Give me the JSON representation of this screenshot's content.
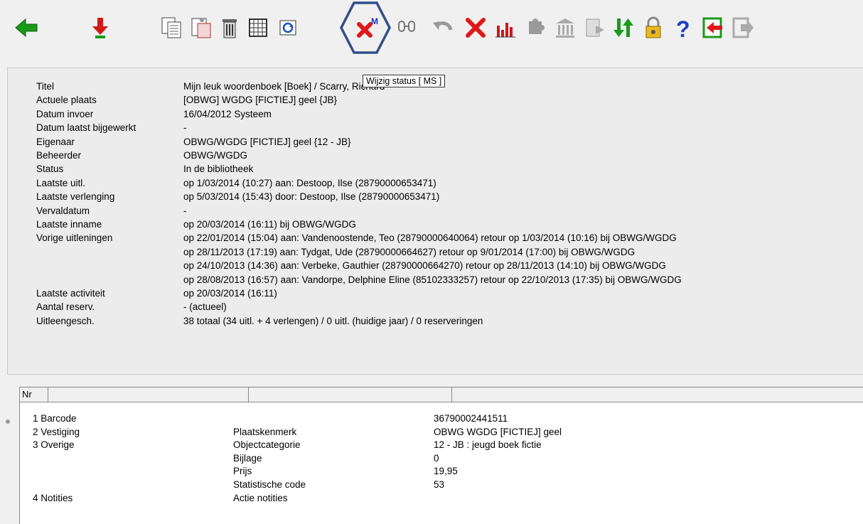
{
  "tooltip": "Wijzig status  [ MS ]",
  "toolbar": {
    "icons": [
      "back-arrow-icon",
      "download-arrow-icon",
      "copy-icon",
      "paste-icon",
      "trash-icon",
      "table-icon",
      "refresh-icon",
      "change-status-icon",
      "link-icon",
      "undo-icon",
      "delete-icon",
      "bar-chart-icon",
      "puzzle-icon",
      "library-icon",
      "export-icon",
      "sort-icon",
      "lock-icon",
      "help-icon",
      "exit-icon",
      "logout-icon"
    ],
    "highlight_color": "#2f4f8a"
  },
  "info": {
    "rows": [
      {
        "label": "Titel",
        "value": "Mijn leuk woordenboek  [Boek] / Scarry, Richard"
      },
      {
        "label": "Actuele plaats",
        "value": "[OBWG] WGDG [FICTIEJ] geel     {JB}"
      },
      {
        "label": "Datum invoer",
        "value": "16/04/2012 Systeem"
      },
      {
        "label": "Datum laatst bijgewerkt",
        "value": "-"
      },
      {
        "label": "Eigenaar",
        "value": "OBWG/WGDG [FICTIEJ] geel   {12 - JB}"
      },
      {
        "label": "Beheerder",
        "value": "OBWG/WGDG"
      },
      {
        "label": "Status",
        "value": "In de bibliotheek"
      },
      {
        "label": "Laatste uitl.",
        "value": "op 1/03/2014 (10:27) aan:  Destoop, Ilse (28790000653471)"
      },
      {
        "label": "Laatste verlenging",
        "value": "op 5/03/2014 (15:43) door: Destoop, Ilse (28790000653471)"
      },
      {
        "label": "Vervaldatum",
        "value": "-"
      },
      {
        "label": "Laatste inname",
        "value": "op 20/03/2014 (16:11) bij OBWG/WGDG"
      },
      {
        "label": "Vorige uitleningen",
        "value": "op 22/01/2014 (15:04) aan:  Vandenoostende, Teo (28790000640064)     retour op 1/03/2014 (10:16) bij OBWG/WGDG"
      },
      {
        "label": "",
        "value": "op 28/11/2013 (17:19) aan:  Tydgat, Ude (28790000664627)     retour op 9/01/2014 (17:00) bij OBWG/WGDG"
      },
      {
        "label": "",
        "value": "op 24/10/2013 (14:36) aan:  Verbeke, Gauthier (28790000664270)     retour op 28/11/2013 (14:10) bij OBWG/WGDG"
      },
      {
        "label": "",
        "value": "op 28/08/2013 (16:57) aan:  Vandorpe, Delphine Eline (85102333257)     retour op 22/10/2013 (17:35) bij OBWG/WGDG"
      },
      {
        "label": "Laatste activiteit",
        "value": "op 20/03/2014 (16:11)"
      },
      {
        "label": "Aantal reserv.",
        "value": "- (actueel)"
      },
      {
        "label": "Uitleengesch.",
        "value": "38 totaal (34 uitl. + 4 verlengen) / 0 uitl. (huidige jaar) / 0 reserveringen"
      }
    ]
  },
  "grid": {
    "header": "Nr",
    "rows": [
      {
        "c1": "1  Barcode",
        "c2": "",
        "c3": "36790002441511"
      },
      {
        "c1": "2  Vestiging",
        "c2": "Plaatskenmerk",
        "c3": "OBWG WGDG [FICTIEJ] geel"
      },
      {
        "c1": "3  Overige",
        "c2": "Objectcategorie",
        "c3": "12 - JB : jeugd boek fictie"
      },
      {
        "c1": "",
        "c2": "Bijlage",
        "c3": "0"
      },
      {
        "c1": "",
        "c2": "Prijs",
        "c3": "19,95"
      },
      {
        "c1": "",
        "c2": "Statistische code",
        "c3": "53"
      },
      {
        "c1": "4  Notities",
        "c2": "Actie notities",
        "c3": ""
      }
    ]
  }
}
